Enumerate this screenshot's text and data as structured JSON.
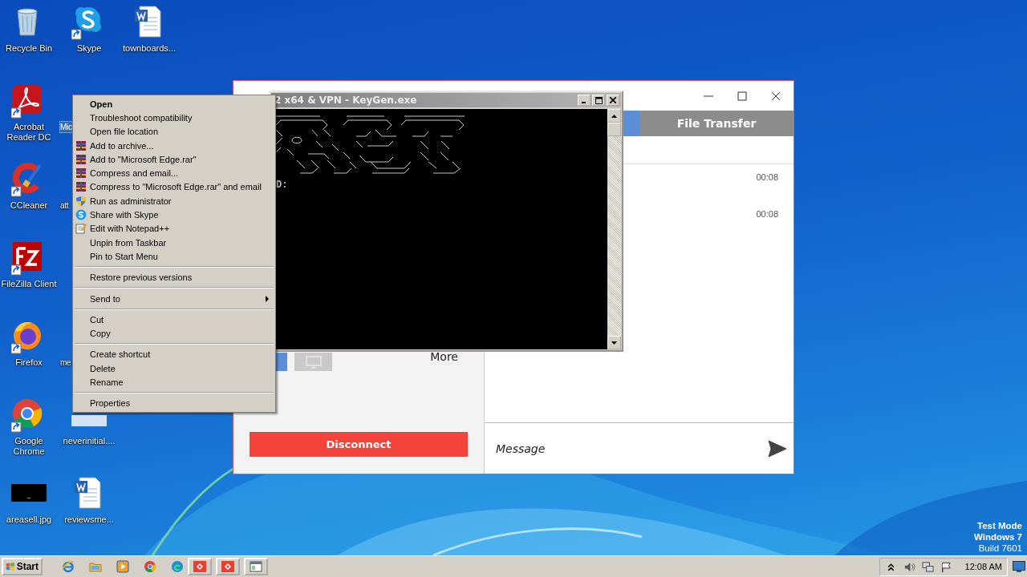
{
  "desktop": {
    "icons": [
      {
        "label": "Recycle Bin",
        "kind": "recycle",
        "shortcut": false,
        "selected": false
      },
      {
        "label": "Skype",
        "kind": "skype",
        "shortcut": true,
        "selected": false
      },
      {
        "label": "townboards...",
        "kind": "word",
        "shortcut": false,
        "selected": false
      },
      {
        "label": "Acrobat Reader DC",
        "kind": "acrobat",
        "shortcut": true,
        "selected": false
      },
      {
        "label": "Mic",
        "kind": "covered",
        "selected": true
      },
      {
        "label": "CCleaner",
        "kind": "ccleaner",
        "shortcut": true,
        "selected": false
      },
      {
        "label": "att",
        "kind": "covered",
        "selected": false
      },
      {
        "label": "FileZilla Client",
        "kind": "filezilla",
        "shortcut": true,
        "selected": false
      },
      {
        "label": "Firefox",
        "kind": "firefox",
        "shortcut": true,
        "selected": false
      },
      {
        "label": "me",
        "kind": "covered",
        "selected": false
      },
      {
        "label": "Google Chrome",
        "kind": "chrome",
        "shortcut": true,
        "selected": false
      },
      {
        "label": "neverinitial....",
        "kind": "blank",
        "shortcut": false,
        "selected": false
      },
      {
        "label": "areasell.jpg",
        "kind": "image",
        "shortcut": false,
        "selected": false
      },
      {
        "label": "reviewsme...",
        "kind": "word",
        "shortcut": false,
        "selected": false
      }
    ]
  },
  "chat_window": {
    "tabs": [
      {
        "label": "File Transfer",
        "selected": false
      }
    ],
    "messages": [
      {
        "time": "00:08"
      },
      {
        "time": "00:08"
      }
    ],
    "tool_buttons": [
      {
        "kind": "primary"
      },
      {
        "kind": "screen"
      }
    ],
    "more": "More",
    "disconnect": "Disconnect",
    "message_field": {
      "placeholder": "Message"
    }
  },
  "console": {
    "title": "2 x64 & VPN - KeyGen.exe",
    "output": [
      "D:"
    ]
  },
  "context_menu": {
    "groups": [
      [
        {
          "label": "Open",
          "kind": "plain",
          "default": true,
          "submenu": false
        },
        {
          "label": "Troubleshoot compatibility",
          "kind": "plain",
          "default": false,
          "submenu": false
        },
        {
          "label": "Open file location",
          "kind": "plain",
          "default": false,
          "submenu": false
        },
        {
          "label": "Add to archive...",
          "kind": "archive",
          "default": false,
          "submenu": false
        },
        {
          "label": "Add to \"Microsoft Edge.rar\"",
          "kind": "archive",
          "default": false,
          "submenu": false
        },
        {
          "label": "Compress and email...",
          "kind": "archive",
          "default": false,
          "submenu": false
        },
        {
          "label": "Compress to \"Microsoft Edge.rar\" and email",
          "kind": "archive",
          "default": false,
          "submenu": false
        },
        {
          "label": "Run as administrator",
          "kind": "shield",
          "default": false,
          "submenu": false
        },
        {
          "label": "Share with Skype",
          "kind": "skype",
          "default": false,
          "submenu": false
        },
        {
          "label": "Edit with Notepad++",
          "kind": "notepad",
          "default": false,
          "submenu": false
        },
        {
          "label": "Unpin from Taskbar",
          "kind": "plain",
          "default": false,
          "submenu": false
        },
        {
          "label": "Pin to Start Menu",
          "kind": "plain",
          "default": false,
          "submenu": false
        }
      ],
      [
        {
          "label": "Restore previous versions",
          "kind": "plain",
          "default": false,
          "submenu": false
        }
      ],
      [
        {
          "label": "Send to",
          "kind": "plain",
          "default": false,
          "submenu": true
        }
      ],
      [
        {
          "label": "Cut",
          "kind": "plain",
          "default": false,
          "submenu": false
        },
        {
          "label": "Copy",
          "kind": "plain",
          "default": false,
          "submenu": false
        }
      ],
      [
        {
          "label": "Create shortcut",
          "kind": "plain",
          "default": false,
          "submenu": false
        },
        {
          "label": "Delete",
          "kind": "plain",
          "default": false,
          "submenu": false
        },
        {
          "label": "Rename",
          "kind": "plain",
          "default": false,
          "submenu": false
        }
      ],
      [
        {
          "label": "Properties",
          "kind": "plain",
          "default": false,
          "submenu": false
        }
      ]
    ]
  },
  "os_notice": [
    {
      "text": "Test Mode",
      "bold": true
    },
    {
      "text": "Windows 7",
      "bold": true
    },
    {
      "text": "Build 7601",
      "bold": false
    }
  ],
  "taskbar": {
    "start": "Start",
    "items": [
      {
        "kind": "ie"
      },
      {
        "kind": "explorer"
      },
      {
        "kind": "media"
      },
      {
        "kind": "chrome"
      },
      {
        "kind": "edge"
      },
      {
        "kind": "app-red"
      },
      {
        "kind": "app-red"
      },
      {
        "kind": "app-window"
      }
    ],
    "tray": [
      {
        "kind": "chevron"
      },
      {
        "kind": "speaker"
      },
      {
        "kind": "network"
      },
      {
        "kind": "flag"
      }
    ],
    "clock": "12:08 AM"
  }
}
